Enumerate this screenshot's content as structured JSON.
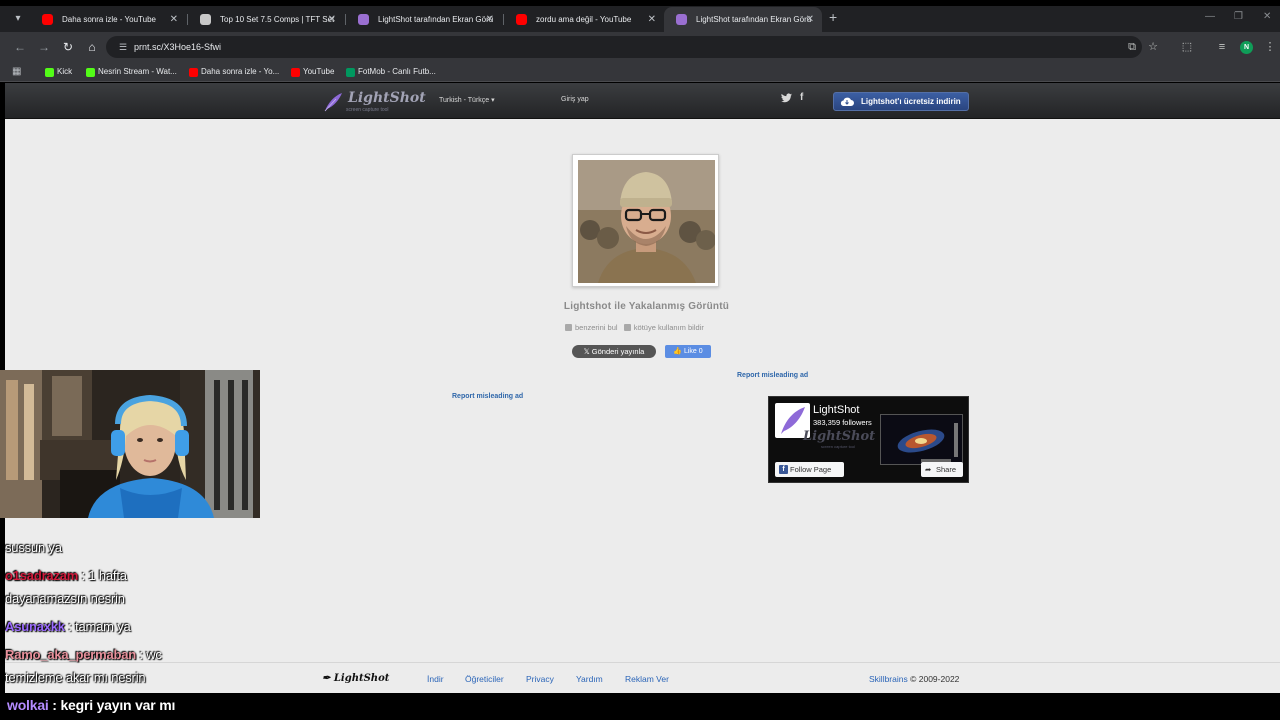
{
  "browser": {
    "tabs": [
      {
        "title": "Daha sonra izle - YouTube",
        "favicon": "youtube-icon"
      },
      {
        "title": "Top 10 Set 7.5 Comps | TFT Set",
        "favicon": "tft-icon"
      },
      {
        "title": "LightShot tarafından Ekran Görü",
        "favicon": "lightshot-icon"
      },
      {
        "title": "zordu ama değil - YouTube",
        "favicon": "youtube-icon"
      },
      {
        "title": "LightShot tarafından Ekran Görü",
        "favicon": "lightshot-icon",
        "active": true
      }
    ],
    "url": "prnt.sc/X3Hoe16-Sfwi",
    "profile_initial": "N",
    "bookmarks": [
      {
        "label": "Kick",
        "favicon": "kick-icon"
      },
      {
        "label": "Nesrin Stream - Wat...",
        "favicon": "kick-icon"
      },
      {
        "label": "Daha sonra izle - Yo...",
        "favicon": "youtube-icon"
      },
      {
        "label": "YouTube",
        "favicon": "youtube-icon"
      },
      {
        "label": "FotMob - Canlı Futb...",
        "favicon": "fotmob-icon"
      }
    ]
  },
  "lightshot": {
    "logo_name": "LightShot",
    "logo_tagline": "screen capture tool",
    "language": "Turkish - Türkçe",
    "login": "Giriş yap",
    "download_button": "Lightshot'ı ücretsiz indirin",
    "image_title": "Lightshot ile Yakalanmış Görüntü",
    "similar_link": "benzerini bul",
    "report_abuse_link": "kötüye kullanım bildir",
    "tweet_button": "Gönderi yayınla",
    "like_button": "Like 0",
    "report_ad_1": "Report misleading ad",
    "report_ad_2": "Report misleading ad",
    "fb_widget": {
      "page_name": "LightShot",
      "followers": "383,359 followers",
      "watermark": "LightShot",
      "watermark_tag": "screen capture tool",
      "follow_button": "Follow Page",
      "share_button": "Share"
    },
    "footer": {
      "logo": "LightShot",
      "links": [
        "İndir",
        "Öğreticiler",
        "Privacy",
        "Yardım",
        "Reklam Ver"
      ],
      "company": "Skillbrains",
      "copyright": "© 2009-2022"
    }
  },
  "chat": {
    "messages": [
      {
        "user": "",
        "text": "sussun ya",
        "color": "#ffffff"
      },
      {
        "user": "o1sadrazam",
        "text": ": 1 hafta",
        "color": "#d21a3c"
      },
      {
        "user": "",
        "text": "dayanamazsın nesrin",
        "color": "#ffffff"
      },
      {
        "user": "Asunaxkk",
        "text": ": tamam ya",
        "color": "#9b6bff"
      },
      {
        "user": "Ramo_aka_permaban",
        "text": ": wc",
        "color": "#e8919c"
      },
      {
        "user": "",
        "text": "temizleme akar mı nesrin",
        "color": "#ffffff"
      }
    ],
    "bottom": {
      "user": "wolkai",
      "text": ": kegri yayın var mı",
      "color": "#b48cff"
    }
  },
  "colors": {
    "chrome_dark": "#202124",
    "chrome_mid": "#35363a",
    "page_bg": "#ececec",
    "link_blue": "#2b65b8",
    "download_blue": "#2f4f8f"
  }
}
